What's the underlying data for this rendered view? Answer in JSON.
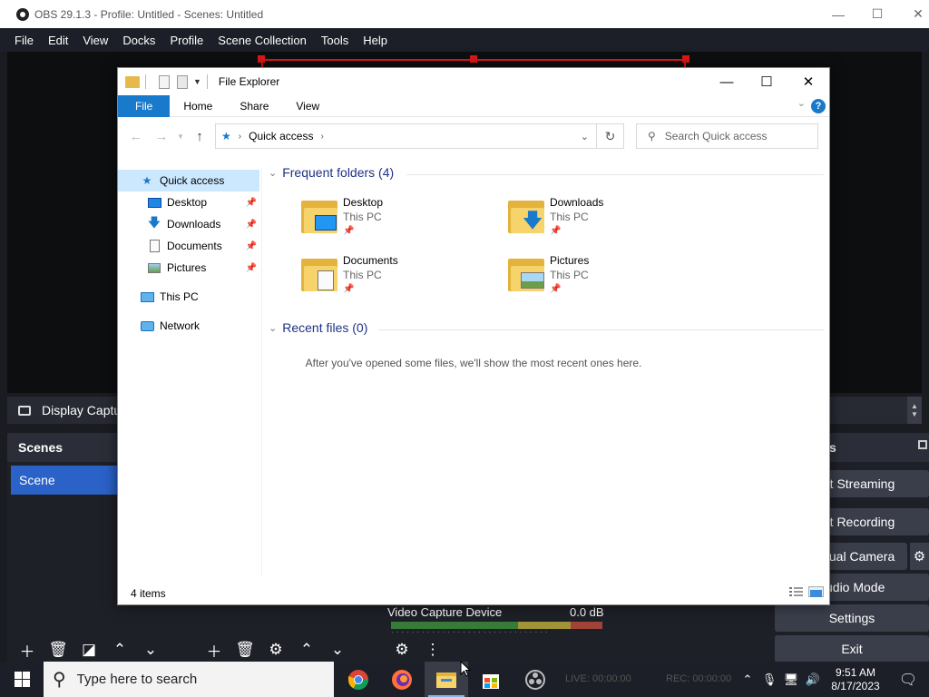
{
  "obs": {
    "title": "OBS 29.1.3 - Profile: Untitled - Scenes: Untitled",
    "menu": [
      "File",
      "Edit",
      "View",
      "Docks",
      "Profile",
      "Scene Collection",
      "Tools",
      "Help"
    ],
    "source_bar_text": "Display Captu",
    "scenes_header": "Scenes",
    "scene_item": "Scene",
    "controls_header_fragment": "s",
    "buttons": {
      "start_streaming": "rt Streaming",
      "start_recording": "rt Recording",
      "virtual_camera": "tual Camera",
      "studio_mode": "udio Mode",
      "settings": "Settings",
      "exit": "Exit"
    },
    "audio": {
      "source": "Video Capture Device",
      "level": "0.0 dB"
    },
    "status": {
      "live": "LIVE: 00:00:00",
      "rec": "REC: 00:00:00"
    }
  },
  "explorer": {
    "title": "File Explorer",
    "ribbon_tabs": [
      "File",
      "Home",
      "Share",
      "View"
    ],
    "help": "?",
    "address": "Quick access",
    "search_placeholder": "Search Quick access",
    "nav": [
      {
        "label": "Quick access",
        "icon": "star-icon",
        "selected": true
      },
      {
        "label": "Desktop",
        "icon": "desktop-folder-icon",
        "pinned": true
      },
      {
        "label": "Downloads",
        "icon": "download-icon",
        "pinned": true
      },
      {
        "label": "Documents",
        "icon": "documents-icon",
        "pinned": true
      },
      {
        "label": "Pictures",
        "icon": "pictures-icon",
        "pinned": true
      },
      {
        "label": "This PC",
        "icon": "computer-icon"
      },
      {
        "label": "Network",
        "icon": "network-icon"
      }
    ],
    "frequent_header": "Frequent folders (4)",
    "folders": [
      {
        "name": "Desktop",
        "location": "This PC",
        "icon": "desktop-folder-icon"
      },
      {
        "name": "Downloads",
        "location": "This PC",
        "icon": "downloads-folder-icon"
      },
      {
        "name": "Documents",
        "location": "This PC",
        "icon": "documents-folder-icon"
      },
      {
        "name": "Pictures",
        "location": "This PC",
        "icon": "pictures-folder-icon"
      }
    ],
    "recent_header": "Recent files (0)",
    "recent_empty": "After you've opened some files, we'll show the most recent ones here.",
    "status": "4 items"
  },
  "taskbar": {
    "search_placeholder": "Type here to search",
    "apps": [
      "chrome-icon",
      "firefox-icon",
      "file-explorer-icon",
      "store-icon",
      "obs-icon"
    ],
    "time": "9:51 AM",
    "date": "8/17/2023"
  },
  "colors": {
    "obs_bg": "#1a1c22",
    "accent_blue": "#1979ca",
    "scene_selected": "#2b62c8",
    "recording_red": "#e01818"
  }
}
